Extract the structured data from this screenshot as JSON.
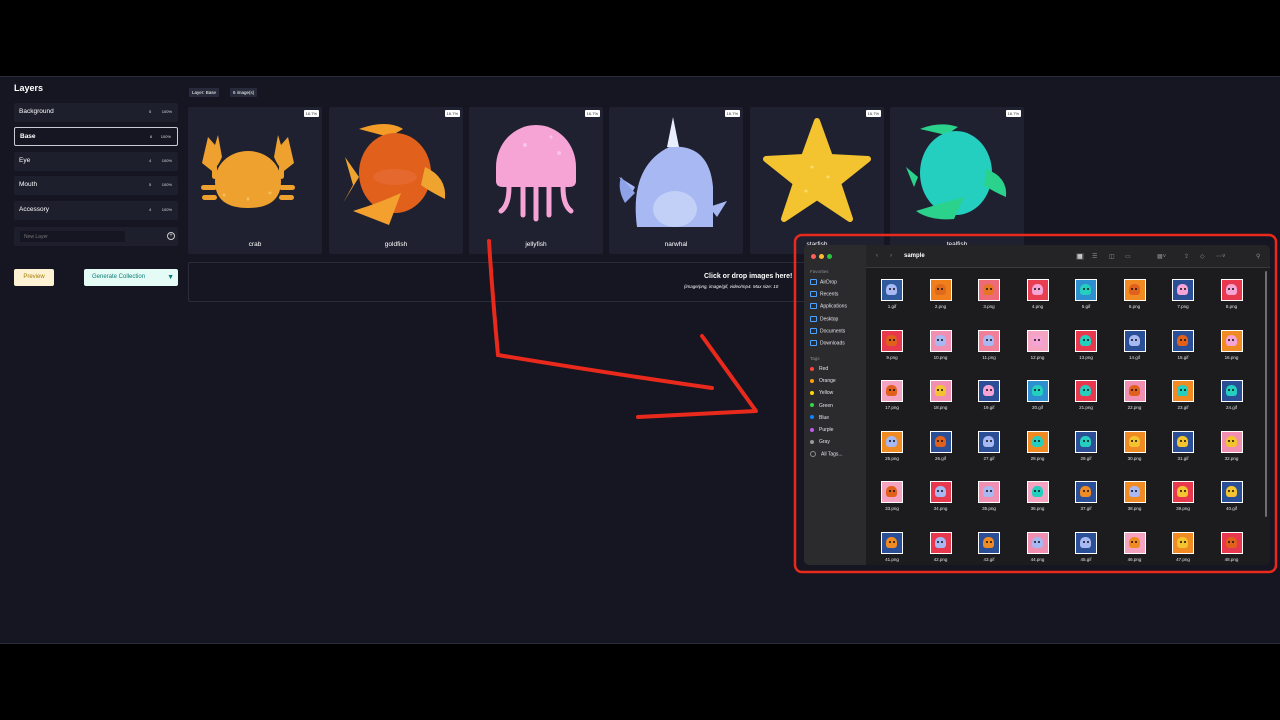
{
  "layers": {
    "title": "Layers",
    "items": [
      {
        "name": "Background",
        "count": "5",
        "pct": "100%"
      },
      {
        "name": "Base",
        "count": "6",
        "pct": "100%"
      },
      {
        "name": "Eye",
        "count": "4",
        "pct": "100%"
      },
      {
        "name": "Mouth",
        "count": "5",
        "pct": "100%"
      },
      {
        "name": "Accessory",
        "count": "4",
        "pct": "100%"
      }
    ],
    "new_layer_placeholder": "New Layer"
  },
  "buttons": {
    "preview": "Preview",
    "generate": "Generate Collection",
    "generate_arrow": "▼"
  },
  "breadcrumb": {
    "layer": "Layer: Base",
    "images": "6 image(s)"
  },
  "tiles": [
    {
      "name": "crab",
      "pct": "16.7%"
    },
    {
      "name": "goldfish",
      "pct": "16.7%"
    },
    {
      "name": "jellyfish",
      "pct": "16.7%"
    },
    {
      "name": "narwhal",
      "pct": "16.7%"
    },
    {
      "name": "starfish",
      "pct": "16.7%"
    },
    {
      "name": "tealfish",
      "pct": "16.7%"
    }
  ],
  "dropzone": {
    "title": "Click or drop images here!",
    "subtitle": "(image/png, image/gif, video/mp4. Max size: 10"
  },
  "finder": {
    "folder": "sample",
    "favorites_label": "Favorites",
    "favorites": [
      "AirDrop",
      "Recents",
      "Applications",
      "Desktop",
      "Documents",
      "Downloads"
    ],
    "tags_label": "Tags",
    "tags": [
      {
        "name": "Red",
        "color": "#ff453a"
      },
      {
        "name": "Orange",
        "color": "#ff9f0a"
      },
      {
        "name": "Yellow",
        "color": "#ffd60a"
      },
      {
        "name": "Green",
        "color": "#32d74b"
      },
      {
        "name": "Blue",
        "color": "#0a84ff"
      },
      {
        "name": "Purple",
        "color": "#bf5af2"
      },
      {
        "name": "Gray",
        "color": "#98989d"
      },
      {
        "name": "All Tags...",
        "color": ""
      }
    ],
    "files": [
      {
        "name": "1.gif",
        "bg": "#2f5a9e",
        "fg": "#a7b8f2"
      },
      {
        "name": "2.png",
        "bg": "#f07f1b",
        "fg": "#e06a1c"
      },
      {
        "name": "3.png",
        "bg": "#ef6a77",
        "fg": "#e67524"
      },
      {
        "name": "4.png",
        "bg": "#e93d52",
        "fg": "#f6a3d6"
      },
      {
        "name": "5.gif",
        "bg": "#2d8fd0",
        "fg": "#24cfc0"
      },
      {
        "name": "6.png",
        "bg": "#f08a22",
        "fg": "#e0601c"
      },
      {
        "name": "7.png",
        "bg": "#2a4f96",
        "fg": "#f6a3d6"
      },
      {
        "name": "8.png",
        "bg": "#e7384e",
        "fg": "#f6a3d6"
      },
      {
        "name": "9.png",
        "bg": "#e7384e",
        "fg": "#e0601c"
      },
      {
        "name": "10.png",
        "bg": "#f08fb1",
        "fg": "#a7b8f2"
      },
      {
        "name": "11.png",
        "bg": "#f07f9a",
        "fg": "#a7b8f2"
      },
      {
        "name": "12.png",
        "bg": "#f4a4c0",
        "fg": "#f6a3d6"
      },
      {
        "name": "13.png",
        "bg": "#e7384e",
        "fg": "#24cfc0"
      },
      {
        "name": "14.gif",
        "bg": "#2a4f96",
        "fg": "#a7b8f2"
      },
      {
        "name": "15.gif",
        "bg": "#2a4f96",
        "fg": "#e0601c"
      },
      {
        "name": "16.png",
        "bg": "#f08a22",
        "fg": "#f6a3d6"
      },
      {
        "name": "17.png",
        "bg": "#f4a4c0",
        "fg": "#e0601c"
      },
      {
        "name": "18.png",
        "bg": "#f08fb1",
        "fg": "#f4c430"
      },
      {
        "name": "19.gif",
        "bg": "#2a4f96",
        "fg": "#f6a3d6"
      },
      {
        "name": "20.gif",
        "bg": "#2d8fd0",
        "fg": "#24cfc0"
      },
      {
        "name": "21.png",
        "bg": "#e7384e",
        "fg": "#24cfc0"
      },
      {
        "name": "22.png",
        "bg": "#f08fb1",
        "fg": "#e0601c"
      },
      {
        "name": "23.gif",
        "bg": "#f08a22",
        "fg": "#24cfc0"
      },
      {
        "name": "24.gif",
        "bg": "#2a4f96",
        "fg": "#24cfc0"
      },
      {
        "name": "25.png",
        "bg": "#f08a22",
        "fg": "#a7b8f2"
      },
      {
        "name": "26.gif",
        "bg": "#2a4f96",
        "fg": "#e0601c"
      },
      {
        "name": "27.gif",
        "bg": "#2a4f96",
        "fg": "#a7b8f2"
      },
      {
        "name": "28.png",
        "bg": "#f08a22",
        "fg": "#24cfc0"
      },
      {
        "name": "29.gif",
        "bg": "#2a4f96",
        "fg": "#24cfc0"
      },
      {
        "name": "30.png",
        "bg": "#f08a22",
        "fg": "#f4c430"
      },
      {
        "name": "31.gif",
        "bg": "#2a4f96",
        "fg": "#f4c430"
      },
      {
        "name": "32.png",
        "bg": "#f08fb1",
        "fg": "#f4c430"
      },
      {
        "name": "33.png",
        "bg": "#f4a4c0",
        "fg": "#e0601c"
      },
      {
        "name": "34.png",
        "bg": "#e7384e",
        "fg": "#a7b8f2"
      },
      {
        "name": "35.png",
        "bg": "#f08fb1",
        "fg": "#a7b8f2"
      },
      {
        "name": "36.png",
        "bg": "#f4a4c0",
        "fg": "#24cfc0"
      },
      {
        "name": "37.gif",
        "bg": "#2a4f96",
        "fg": "#f08a22"
      },
      {
        "name": "38.png",
        "bg": "#f08a22",
        "fg": "#a7b8f2"
      },
      {
        "name": "39.png",
        "bg": "#e7384e",
        "fg": "#f4c430"
      },
      {
        "name": "40.gif",
        "bg": "#2a4f96",
        "fg": "#f4c430"
      },
      {
        "name": "41.png",
        "bg": "#2a4f96",
        "fg": "#f08a22"
      },
      {
        "name": "42.png",
        "bg": "#e7384e",
        "fg": "#a7b8f2"
      },
      {
        "name": "43.gif",
        "bg": "#2a4f96",
        "fg": "#f08a22"
      },
      {
        "name": "44.png",
        "bg": "#f08fb1",
        "fg": "#a7b8f2"
      },
      {
        "name": "45.gif",
        "bg": "#2a4f96",
        "fg": "#a7b8f2"
      },
      {
        "name": "46.png",
        "bg": "#f4a4c0",
        "fg": "#f08a22"
      },
      {
        "name": "47.png",
        "bg": "#f08a22",
        "fg": "#f4c430"
      },
      {
        "name": "48.png",
        "bg": "#e7384e",
        "fg": "#e0601c"
      }
    ]
  },
  "colors": {
    "annotation": "#e8291c"
  }
}
